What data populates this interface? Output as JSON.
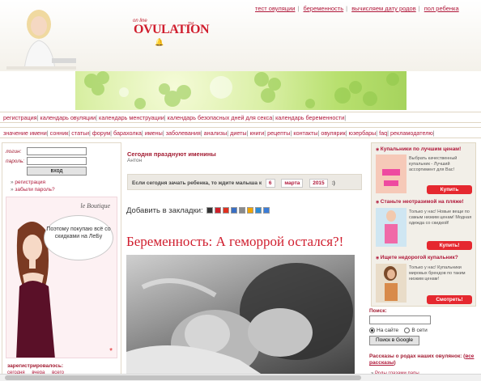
{
  "header": {
    "logo": {
      "online": "on line",
      "word": "OVULATION",
      "tm": "TM"
    },
    "top_links": [
      "тест овуляции",
      "беременность",
      "вычисляем дату родов",
      "пол ребенка"
    ]
  },
  "nav1": [
    "регистрация",
    "календарь овуляции",
    "календарь менструации",
    "календарь безопасных дней для секса",
    "календарь беременности"
  ],
  "nav2": [
    "значение имени",
    "сонник",
    "статьи",
    "форум",
    "барахолка",
    "имены",
    "заболевания",
    "анализы",
    "диеты",
    "книги",
    "рецепты",
    "контакты",
    "овулярик",
    "юзербары",
    "faq",
    "рекламодателю"
  ],
  "left": {
    "login_label": "логин:",
    "password_label": "пароль:",
    "login_button": "вход",
    "links": [
      "регистрация",
      "забыли пароль?"
    ],
    "ad": {
      "brand": "le Boutique",
      "bubble": "Поэтому покупаю всё со скидками на ЛеБу",
      "star": "*"
    },
    "registered_title": "зарегистрировалось:",
    "registered_tabs": [
      "сегодня",
      "вчера",
      "всего"
    ]
  },
  "center": {
    "today_title": "Сегодня празднуют именины",
    "today_name": "Антон",
    "calc": {
      "prefix": "Если сегодня зачать ребенка, то ждите малыша к",
      "day": "6",
      "month": "марта",
      "year": "2015",
      "suffix": ":)"
    },
    "bookmarks_label": "Добавить в закладки:",
    "bookmark_icons": [
      {
        "name": "bookmark-icon-1",
        "color": "#333333"
      },
      {
        "name": "bookmark-icon-2",
        "color": "#d0202a"
      },
      {
        "name": "bookmark-icon-3",
        "color": "#e03020"
      },
      {
        "name": "bookmark-icon-4",
        "color": "#3a6fc4"
      },
      {
        "name": "bookmark-icon-5",
        "color": "#8a8a8a"
      },
      {
        "name": "bookmark-icon-6",
        "color": "#f2a500"
      },
      {
        "name": "bookmark-icon-7",
        "color": "#2c8bd6"
      },
      {
        "name": "bookmark-icon-8",
        "color": "#3b7dd8"
      }
    ],
    "article_title": "Беременность: А геморрой остался?!"
  },
  "right": {
    "ads": [
      {
        "title": "Купальники по лучшим ценам!",
        "text": "Выбрать качественный купальник - Лучший ассортимент для Вас!",
        "button": "Купить"
      },
      {
        "title": "Станьте неотразимой на пляже!",
        "text": "Только у нас! Новые вещи по самым низким ценам! Модная одежда со скидкой!",
        "button": "Купить!"
      },
      {
        "title": "Ищете недорогой купальник?",
        "text": "Только у нас! Купальники мировых брендов по таким низким ценам!",
        "button": "Смотреть!"
      }
    ],
    "search_label": "Поиск:",
    "radio_site": "На сайте",
    "radio_web": "В сети",
    "search_button": "Поиск в Google",
    "stories_prefix": "Рассказы о родах наших овулянок:",
    "stories_link": "все рассказы",
    "story_first": "Роды глазами папы"
  },
  "colors": {
    "accent": "#b0183a",
    "title_red": "#d01e2e",
    "ad_button": "#e5282f"
  }
}
